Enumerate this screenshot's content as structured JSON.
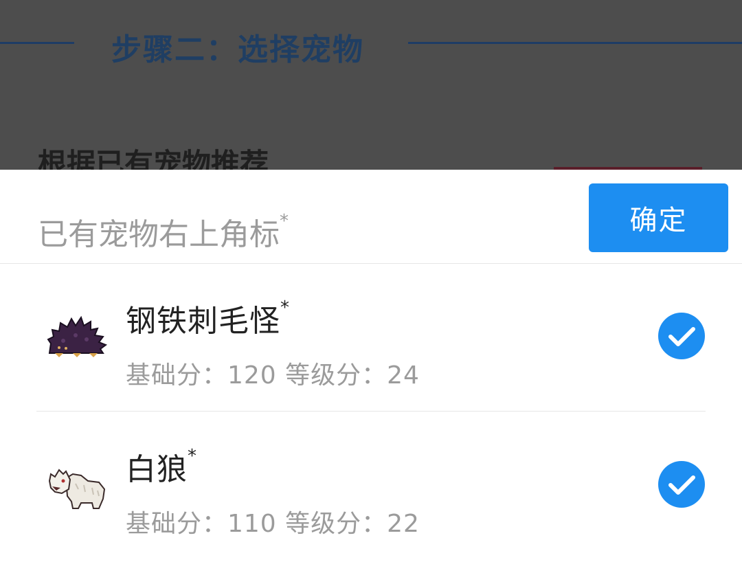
{
  "background": {
    "step_title": "步骤二：选择宠物",
    "subtitle": "根据已有宠物推荐"
  },
  "sheet": {
    "title": "已有宠物右上角标",
    "title_asterisk": "*",
    "confirm_label": "确定"
  },
  "pets": [
    {
      "name": "钢铁刺毛怪",
      "asterisk": "*",
      "stats": "基础分：120 等级分：24",
      "selected": true,
      "icon": "spiky-hedgehog-icon"
    },
    {
      "name": "白狼",
      "asterisk": "*",
      "stats": "基础分：110 等级分：22",
      "selected": true,
      "icon": "white-wolf-icon"
    }
  ],
  "colors": {
    "accent": "#1d8ef1",
    "overlay": "#4d4d4d",
    "step_title": "#1f3e63",
    "muted_text": "#9b9b9b"
  }
}
